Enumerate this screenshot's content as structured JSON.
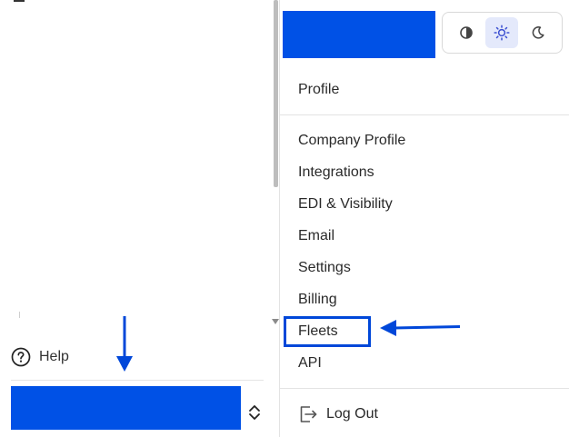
{
  "sidebar": {
    "help_label": "Help",
    "account_color": "#0051e6"
  },
  "menu": {
    "header_color": "#0051e6",
    "theme_options": [
      {
        "name": "contrast-icon",
        "active": false
      },
      {
        "name": "sun-icon",
        "active": true
      },
      {
        "name": "moon-icon",
        "active": false
      }
    ],
    "profile_label": "Profile",
    "items": [
      {
        "label": "Company Profile"
      },
      {
        "label": "Integrations"
      },
      {
        "label": "EDI & Visibility"
      },
      {
        "label": "Email"
      },
      {
        "label": "Settings"
      },
      {
        "label": "Billing"
      },
      {
        "label": "Fleets"
      },
      {
        "label": "API"
      }
    ],
    "logout_label": "Log Out"
  },
  "annotations": {
    "color": "#0047d9"
  }
}
